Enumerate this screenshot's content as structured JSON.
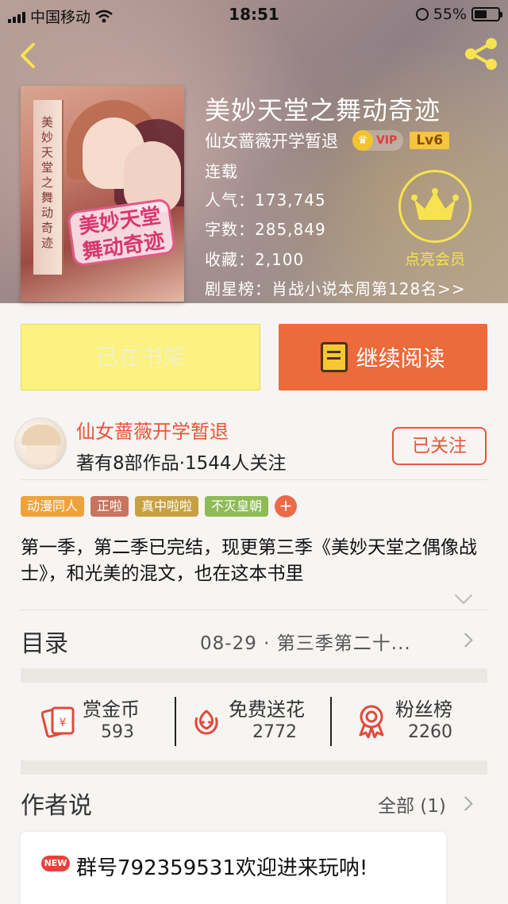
{
  "status_bar": {
    "carrier": "中国移动",
    "time": "18:51",
    "battery": "55%"
  },
  "book": {
    "title": "美妙天堂之舞动奇迹",
    "author": "仙女蔷薇开学暂退",
    "vip_label": "VIP",
    "level": "Lv6",
    "state": "连载",
    "popularity": "人气：173,745",
    "word_count": "字数：285,849",
    "favorites": "收藏：2,100",
    "ranking": "剧星榜：肖战小说本周第128名>>",
    "member_label": "点亮会员",
    "cover_spine_text": "美妙天堂之舞动奇迹",
    "cover_logo": "美妙天堂舞动奇迹"
  },
  "actions": {
    "shelf": "已在书架",
    "read": "继续阅读"
  },
  "author_card": {
    "name": "仙女蔷薇开学暂退",
    "stats": "著有8部作品·1544人关注",
    "follow": "已关注"
  },
  "tags": [
    {
      "label": "动漫同人",
      "color": "#f0a23a"
    },
    {
      "label": "正啦",
      "color": "#c8745f"
    },
    {
      "label": "真中啦啦",
      "color": "#c8a042"
    },
    {
      "label": "不灭皇朝",
      "color": "#8dbb55"
    }
  ],
  "tag_add": "+",
  "description": "第一季，第二季已完结，现更第三季《美妙天堂之偶像战士》，和光美的混文，也在这本书里",
  "toc": {
    "label": "目录",
    "latest": "08-29 · 第三季第二十..."
  },
  "stats": [
    {
      "label": "赏金币",
      "value": "593",
      "icon": "red-envelope-icon"
    },
    {
      "label": "免费送花",
      "value": "2772",
      "icon": "flower-icon"
    },
    {
      "label": "粉丝榜",
      "value": "2260",
      "icon": "medal-icon"
    }
  ],
  "author_says": {
    "label": "作者说",
    "all": "全部 (1)",
    "new_badge": "NEW",
    "message": "群号792359531欢迎进来玩呐!"
  },
  "colors": {
    "accent": "#ed6a3a",
    "author_red": "#e7553a",
    "shelf_yellow": "#fbf27f",
    "member_yellow": "#f6e34f"
  }
}
